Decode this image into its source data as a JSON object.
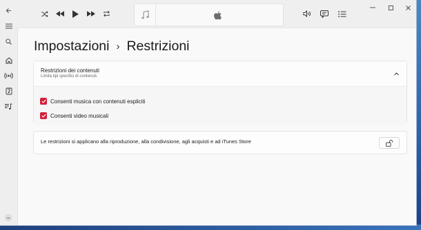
{
  "player": {
    "controls": [
      "shuffle-icon",
      "previous-icon",
      "play-icon",
      "next-icon",
      "repeat-icon"
    ],
    "right_controls": [
      "volume-icon",
      "lyrics-icon",
      "queue-icon"
    ]
  },
  "window_controls": [
    "minimize-icon",
    "maximize-icon",
    "close-icon"
  ],
  "sidebar": {
    "items": [
      "back-icon",
      "menu-icon",
      "search-icon",
      "home-icon",
      "radio-icon",
      "library-icon",
      "playlist-icon"
    ],
    "avatar_initials": "AI"
  },
  "breadcrumb": {
    "parent": "Impostazioni",
    "separator": "›",
    "current": "Restrizioni"
  },
  "content_restrictions": {
    "title": "Restrizioni dei contenuti",
    "subtitle": "Limita tipi specifici di contenuti.",
    "options": [
      {
        "label": "Consenti musica con contenuti espliciti",
        "checked": true
      },
      {
        "label": "Consenti video musicali",
        "checked": true
      }
    ]
  },
  "restrictions_note": {
    "text": "Le restrizioni si applicano alla riproduzione, alla condivisione, agli acquisti e ad iTunes Store",
    "button_icon": "unlock-icon"
  },
  "colors": {
    "accent": "#d21f3c",
    "background": "#f9f9f9"
  }
}
